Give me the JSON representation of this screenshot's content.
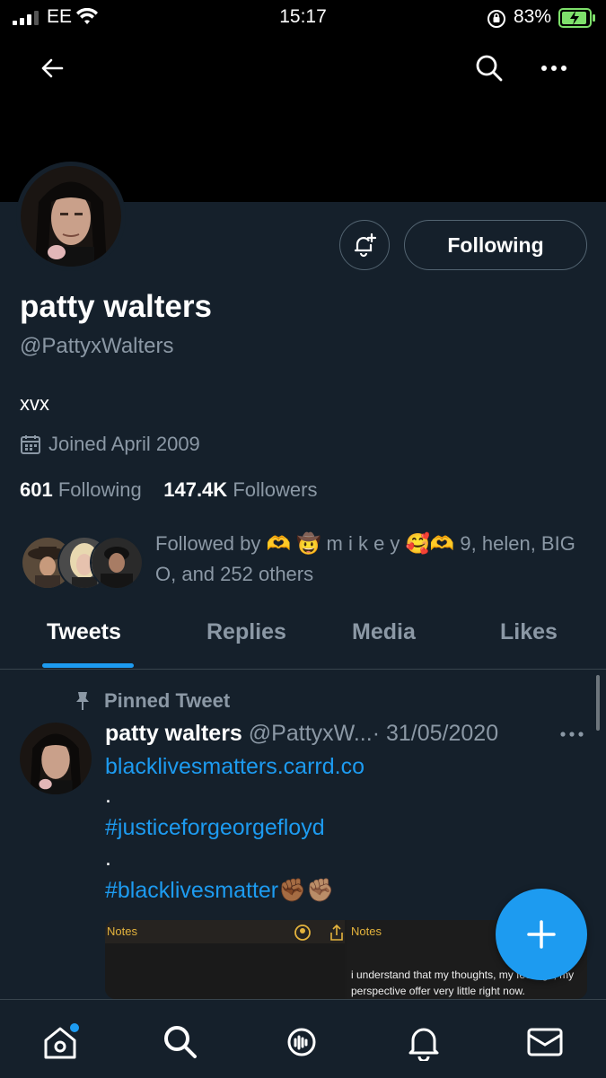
{
  "status_bar": {
    "carrier": "EE",
    "time": "15:17",
    "battery": "83%"
  },
  "profile": {
    "name": "patty walters",
    "handle": "@PattyxWalters",
    "bio": "xvx",
    "joined": "Joined April 2009",
    "following_count": "601",
    "following_label": "Following",
    "followers_count": "147.4K",
    "followers_label": "Followers",
    "follow_button": "Following",
    "followed_by": "Followed by 🫶 🤠 m i k e y 🥰🫶 9, helen, BIG O, and 252 others"
  },
  "tabs": [
    {
      "label": "Tweets",
      "active": true
    },
    {
      "label": "Replies"
    },
    {
      "label": "Media"
    },
    {
      "label": "Likes"
    }
  ],
  "tweet": {
    "pinned_label": "Pinned Tweet",
    "author": "patty walters",
    "handle_truncated": "@PattyxW...",
    "date": "· 31/05/2020",
    "link": "blacklivesmatters.carrd.co",
    "dot1": ".",
    "tag1": "#justiceforgeorgefloyd",
    "dot2": ".",
    "tag2": "#blacklivesmatter✊🏾✊🏽",
    "media": {
      "left_title": "Notes",
      "right_title": "Notes",
      "right_text": "i understand that my thoughts, my feelings, my perspective offer very little right now."
    }
  },
  "colors": {
    "background": "#15202b",
    "accent": "#1d9bf0",
    "muted": "#8b98a5",
    "border": "#38444d"
  },
  "icons": [
    "back-arrow-icon",
    "search-icon",
    "more-icon",
    "bell-plus-icon",
    "calendar-icon",
    "pin-icon",
    "plus-icon",
    "home-icon",
    "search-icon",
    "spaces-icon",
    "bell-icon",
    "mail-icon"
  ]
}
